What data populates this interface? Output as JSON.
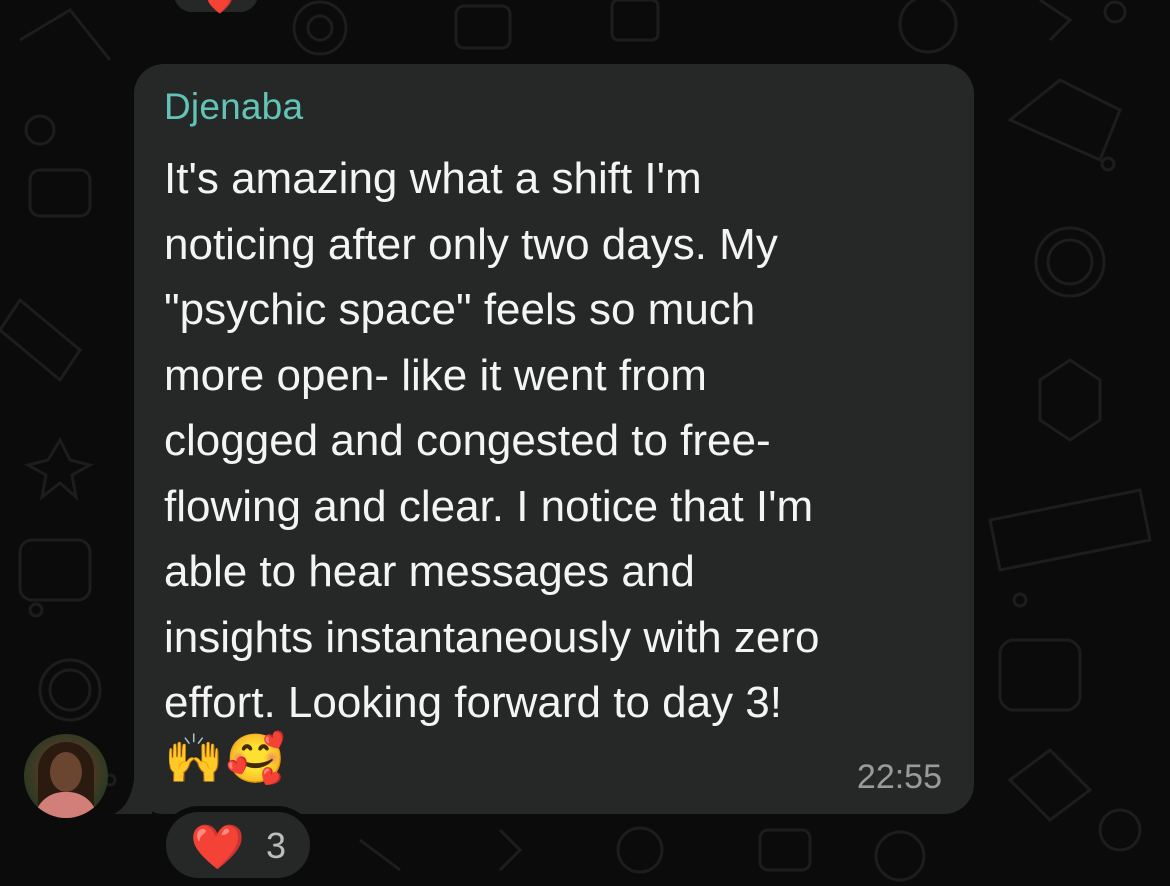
{
  "message": {
    "sender": "Djenaba",
    "text": "It's amazing what a shift I'm\nnoticing after only two days. My\n\"psychic space\" feels so much\nmore open- like it went from\nclogged and congested to free-\nflowing and clear. I notice that I'm\nable to hear messages and\ninsights instantaneously with zero\neffort. Looking forward to day 3!",
    "emojis": "🙌🥰",
    "time": "22:55"
  },
  "reaction": {
    "emoji": "❤️",
    "count": "3"
  },
  "top_reaction": {
    "emoji": "❤️"
  },
  "colors": {
    "background": "#0b0b0b",
    "bubble": "#262827",
    "sender_name": "#62c4b7",
    "message_text": "#f4f4f4",
    "timestamp": "#9a9a9a",
    "heart": "#e0262d"
  },
  "icons": {
    "avatar": "sender-avatar-photo",
    "reaction": "heart-icon"
  }
}
